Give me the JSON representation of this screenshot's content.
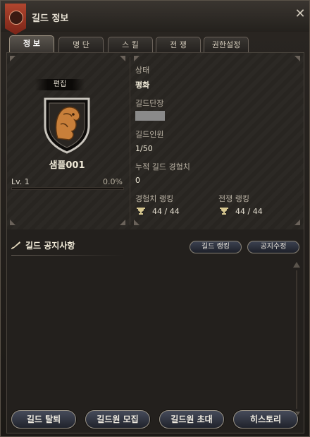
{
  "window": {
    "title": "길드 정보",
    "close_glyph": "✕"
  },
  "tabs": [
    {
      "label": "정 보",
      "active": true
    },
    {
      "label": "명 단",
      "active": false
    },
    {
      "label": "스 킬",
      "active": false
    },
    {
      "label": "전 쟁",
      "active": false
    },
    {
      "label": "권한설정",
      "active": false
    }
  ],
  "guild": {
    "edit_label": "편집",
    "emblem_icon": "lion-shield-icon",
    "name": "샘플001",
    "level": "Lv. 1",
    "exp_percent": "0.0%",
    "exp_fraction": 0.0
  },
  "details": {
    "status_label": "상태",
    "status_value": "평화",
    "leader_label": "길드단장",
    "members_label": "길드인원",
    "members_value": "1/50",
    "exp_label": "누적 길드 경험치",
    "exp_value": "0",
    "exp_rank_label": "경험치 랭킹",
    "exp_rank_value": "44 / 44",
    "war_rank_label": "전쟁 랭킹",
    "war_rank_value": "44 / 44"
  },
  "notice": {
    "title": "길드 공지사항",
    "ranking_button": "길드 랭킹",
    "edit_button": "공지수정"
  },
  "actions": {
    "leave": "길드 탈퇴",
    "recruit": "길드원 모집",
    "invite": "길드원 초대",
    "history": "히스토리"
  },
  "colors": {
    "accent_red": "#b0462f",
    "trophy": "#d8c890"
  }
}
